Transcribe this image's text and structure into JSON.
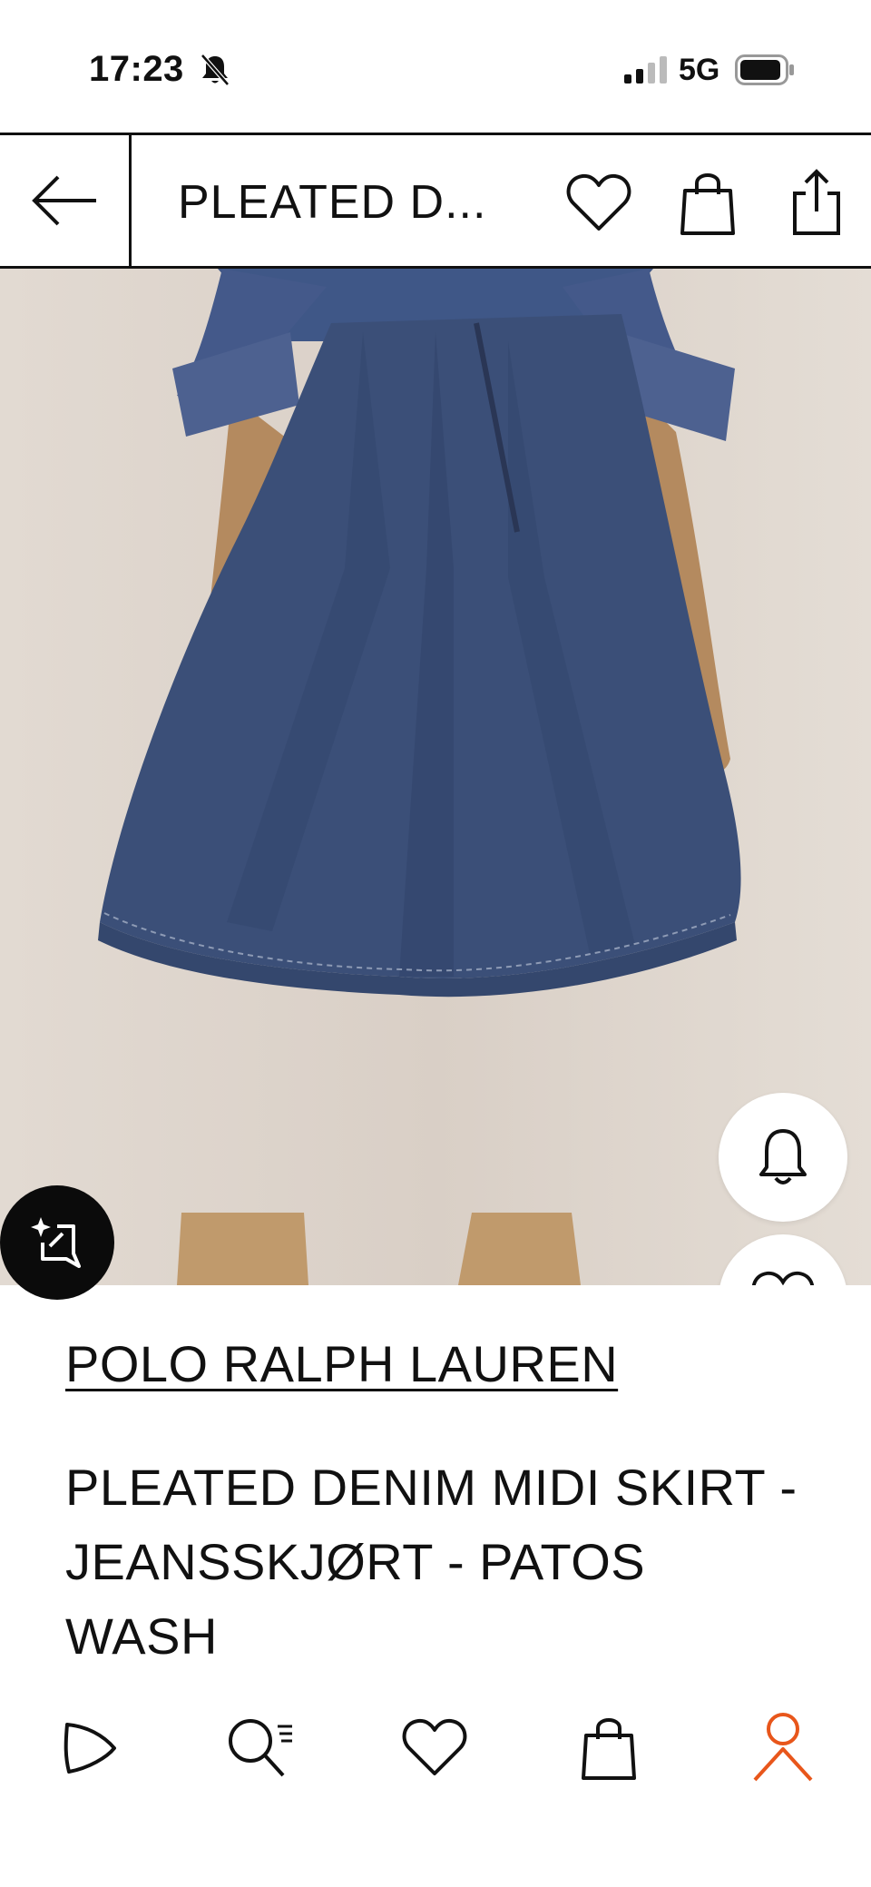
{
  "status_bar": {
    "time": "17:23",
    "network": "5G",
    "icons": [
      "bell-off-icon",
      "signal-icon",
      "battery-icon"
    ]
  },
  "header": {
    "title": "PLEATED D...",
    "icons": [
      "back-arrow-icon",
      "heart-icon",
      "shopping-bag-icon",
      "share-icon"
    ]
  },
  "product": {
    "brand": "POLO RALPH LAUREN",
    "name": "PLEATED DENIM MIDI SKIRT - JEANSSKJØRT - PATOS WASH",
    "image_description_icon": "product-photo"
  },
  "floating_buttons": [
    "notify-bell-icon",
    "wishlist-heart-icon",
    "ai-search-icon"
  ],
  "bottom_nav": {
    "items": [
      {
        "name": "home",
        "icon": "play-logo-icon"
      },
      {
        "name": "search",
        "icon": "search-list-icon"
      },
      {
        "name": "wishlist",
        "icon": "heart-icon"
      },
      {
        "name": "bag",
        "icon": "shopping-bag-icon"
      },
      {
        "name": "profile",
        "icon": "user-icon",
        "active": true
      }
    ]
  },
  "colors": {
    "text": "#111111",
    "accent_active": "#e8561b",
    "denim": "#3b4f78",
    "background_photo": "#ddd3ca"
  }
}
